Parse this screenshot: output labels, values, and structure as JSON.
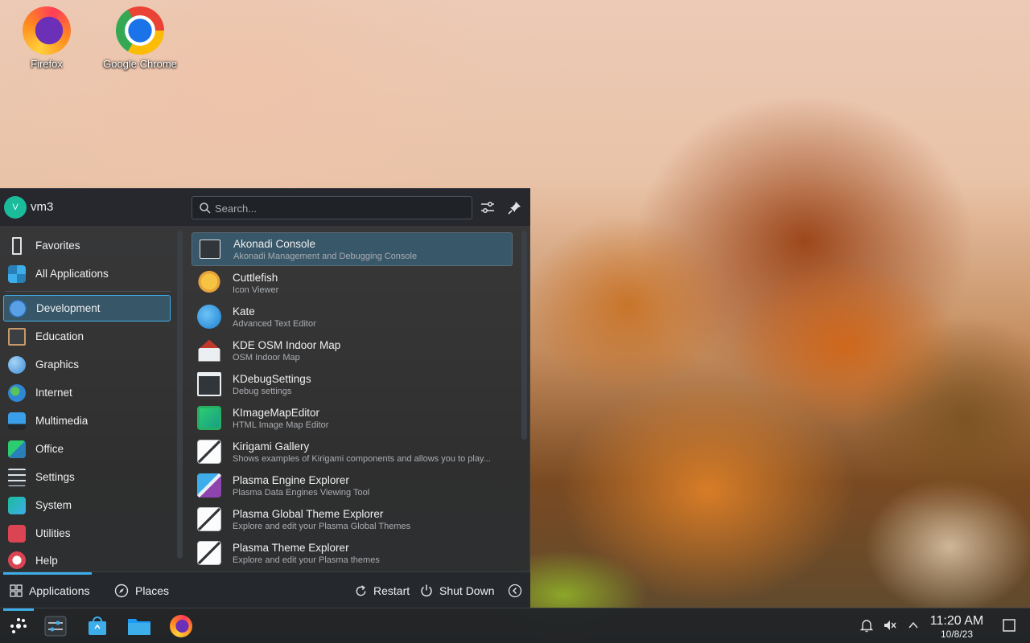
{
  "desktop": {
    "icons": [
      {
        "label": "Firefox",
        "icon": "firefox-icon"
      },
      {
        "label": "Google Chrome",
        "icon": "chrome-icon"
      }
    ]
  },
  "launcher": {
    "user": {
      "initial": "V",
      "name": "vm3"
    },
    "search": {
      "placeholder": "Search..."
    },
    "categories": [
      {
        "label": "Favorites",
        "icon": "bookmark-icon"
      },
      {
        "label": "All Applications",
        "icon": "grid-icon"
      },
      {
        "label": "Development",
        "icon": "development-icon",
        "active": true
      },
      {
        "label": "Education",
        "icon": "education-icon"
      },
      {
        "label": "Graphics",
        "icon": "graphics-icon"
      },
      {
        "label": "Internet",
        "icon": "globe-icon"
      },
      {
        "label": "Multimedia",
        "icon": "multimedia-icon"
      },
      {
        "label": "Office",
        "icon": "office-icon"
      },
      {
        "label": "Settings",
        "icon": "settings-icon"
      },
      {
        "label": "System",
        "icon": "system-icon"
      },
      {
        "label": "Utilities",
        "icon": "utilities-icon"
      },
      {
        "label": "Help",
        "icon": "help-icon"
      }
    ],
    "apps": [
      {
        "name": "Akonadi Console",
        "desc": "Akonadi Management and Debugging Console",
        "icon": "terminal-icon",
        "active": true
      },
      {
        "name": "Cuttlefish",
        "desc": "Icon Viewer",
        "icon": "cuttlefish-icon"
      },
      {
        "name": "Kate",
        "desc": "Advanced Text Editor",
        "icon": "kate-icon"
      },
      {
        "name": "KDE OSM Indoor Map",
        "desc": "OSM Indoor Map",
        "icon": "house-icon"
      },
      {
        "name": "KDebugSettings",
        "desc": "Debug settings",
        "icon": "debug-settings-icon"
      },
      {
        "name": "KImageMapEditor",
        "desc": "HTML Image Map Editor",
        "icon": "image-map-icon"
      },
      {
        "name": "Kirigami Gallery",
        "desc": "Shows examples of Kirigami components and allows you to play...",
        "icon": "pen-icon"
      },
      {
        "name": "Plasma Engine Explorer",
        "desc": "Plasma Data Engines Viewing Tool",
        "icon": "wand-icon"
      },
      {
        "name": "Plasma Global Theme Explorer",
        "desc": "Explore and edit your Plasma Global Themes",
        "icon": "pen-icon"
      },
      {
        "name": "Plasma Theme Explorer",
        "desc": "Explore and edit your Plasma themes",
        "icon": "pen-icon"
      }
    ],
    "footer": {
      "applications_label": "Applications",
      "places_label": "Places",
      "restart_label": "Restart",
      "shutdown_label": "Shut Down"
    }
  },
  "taskbar": {
    "items": [
      "launcher-icon",
      "system-settings-icon",
      "discover-icon",
      "dolphin-icon",
      "firefox-icon"
    ],
    "clock": {
      "time": "11:20 AM",
      "date": "10/8/23"
    }
  },
  "colors": {
    "accent": "#3daee9",
    "panel": "#282c31"
  }
}
